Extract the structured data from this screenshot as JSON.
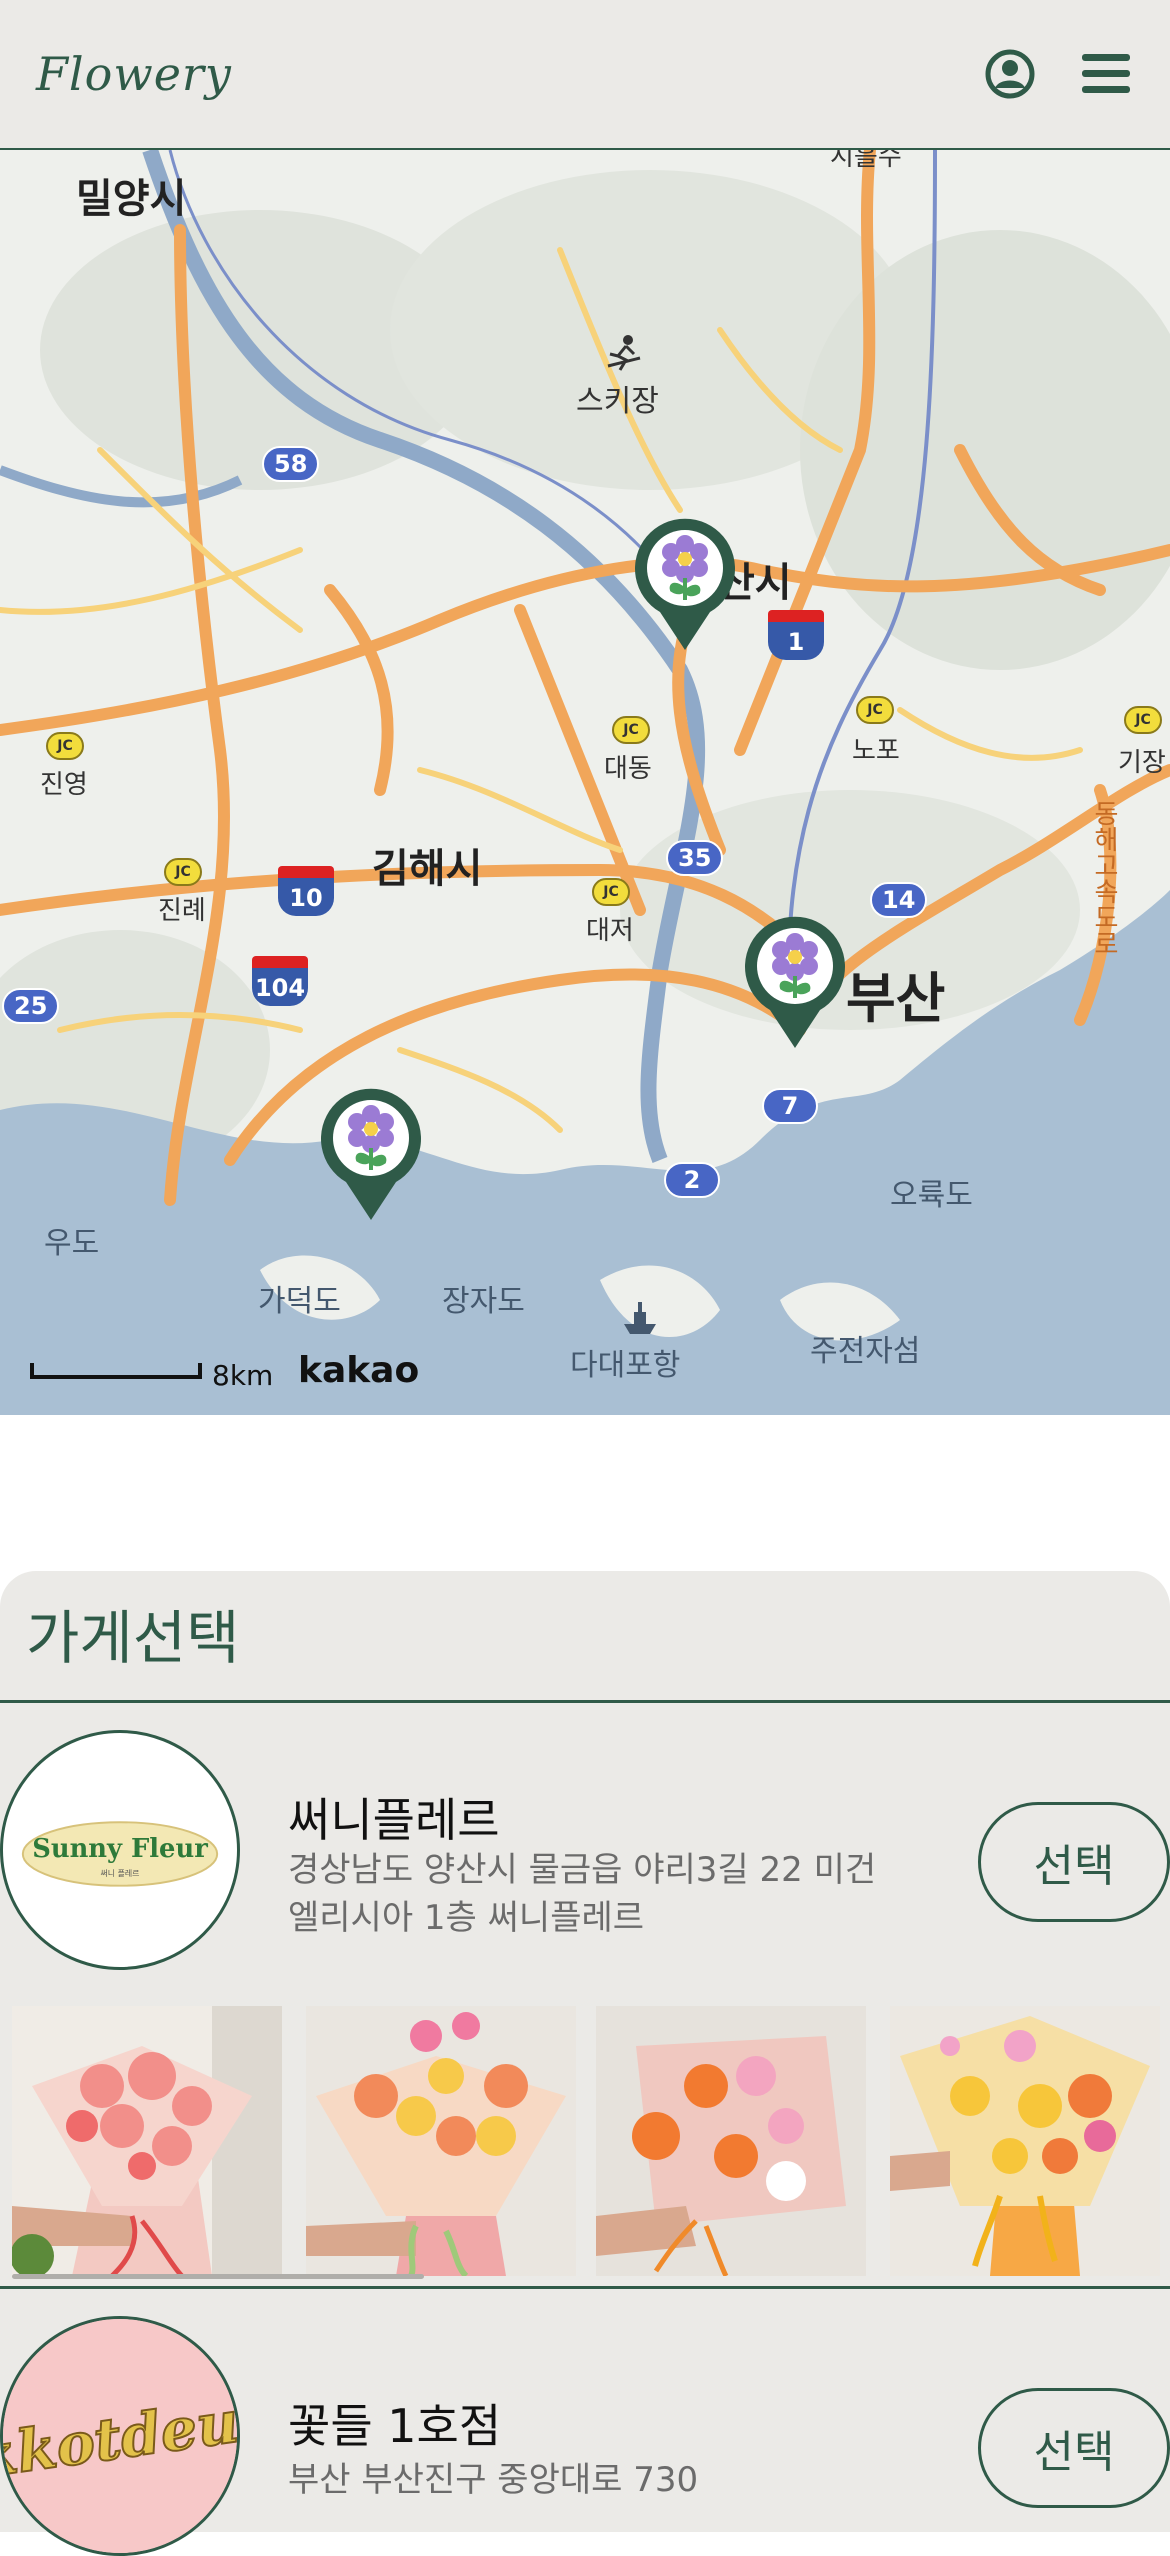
{
  "header": {
    "logo": "Flowery",
    "account_icon": "account-circle-icon",
    "menu_icon": "hamburger-menu-icon"
  },
  "map": {
    "labels": {
      "miryang": "밀양시",
      "ski": "스키장",
      "yangsan": "산시",
      "daedong": "대동",
      "nopo": "노포",
      "gijang": "기장",
      "jinyeong": "진영",
      "gimhae": "김해시",
      "jinrye": "진례",
      "daejeo": "대저",
      "busan": "부산",
      "udo": "우도",
      "gadeokdo": "가덕도",
      "jangjado": "장자도",
      "dadaepo": "다대포항",
      "oryukdo": "오륙도",
      "jujeon": "주전자섬",
      "expressway": "동해고속도로",
      "top_cut": "시흘수"
    },
    "routes": {
      "r58": "58",
      "r35": "35",
      "r14": "14",
      "r25": "25",
      "r7": "7",
      "r2": "2"
    },
    "highways": {
      "h1": "1",
      "h10": "10",
      "h104": "104"
    },
    "jc_label": "JC",
    "scale_text": "8km",
    "attribution": "kakao",
    "pin_icon": "flower-pin-icon"
  },
  "panel": {
    "title": "가게선택",
    "select_label": "선택",
    "stores": [
      {
        "name": "써니플레르",
        "address": "경상남도 양산시 물금읍 야리3길 22 미건 엘리시아 1층 써니플레르",
        "logo_text": "Sunny Fleur",
        "logo_sub": "써니 플레르"
      },
      {
        "name": "꽃들 1호점",
        "address": "부산 부산진구 중앙대로 730",
        "logo_text": "kkotdeul"
      }
    ]
  },
  "colors": {
    "brand": "#2f5a48",
    "panel_bg": "#ebeae7",
    "text_secondary": "#6b6b6b"
  }
}
